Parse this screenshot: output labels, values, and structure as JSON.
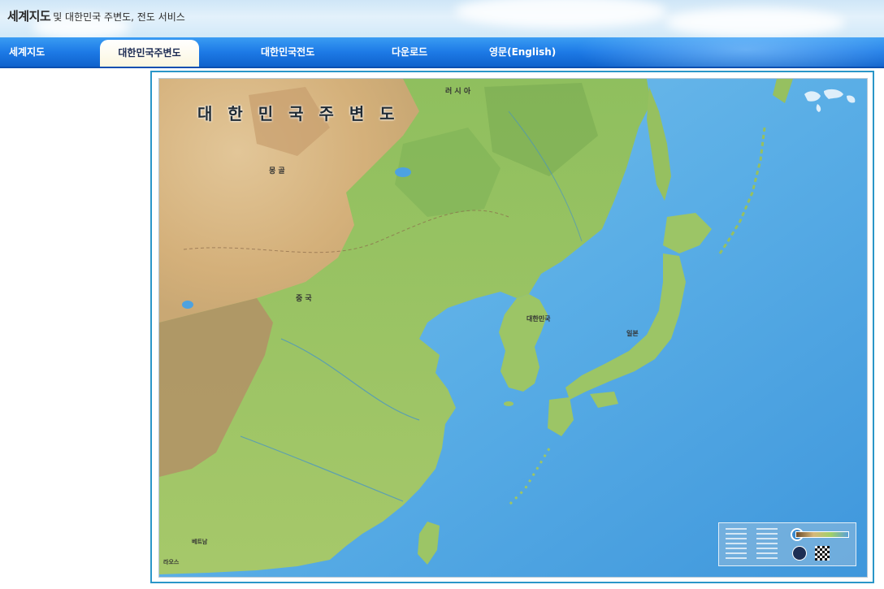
{
  "header": {
    "title_main": "세계지도",
    "title_sub": "및 대한민국 주변도, 전도 서비스"
  },
  "nav": {
    "items": [
      {
        "label": "세계지도",
        "active": false
      },
      {
        "label": "대한민국주변도",
        "active": true
      },
      {
        "label": "대한민국전도",
        "active": false
      },
      {
        "label": "다운로드",
        "active": false
      },
      {
        "label": "영문(English)",
        "active": false
      }
    ]
  },
  "map": {
    "title": "대 한 민 국 주 변 도",
    "labels": {
      "russia": "러 시 아",
      "mongolia": "몽 골",
      "china": "중 국",
      "korea": "대한민국",
      "japan": "일본",
      "vietnam": "베트남",
      "laos": "라오스"
    }
  },
  "colors": {
    "nav_blue": "#1d7ae6",
    "active_tab_bg": "#fbf6df",
    "map_border": "#2a96c8",
    "sea": "#5fb0e6",
    "land_green": "#8ebf62",
    "land_desert": "#d8b98a"
  }
}
